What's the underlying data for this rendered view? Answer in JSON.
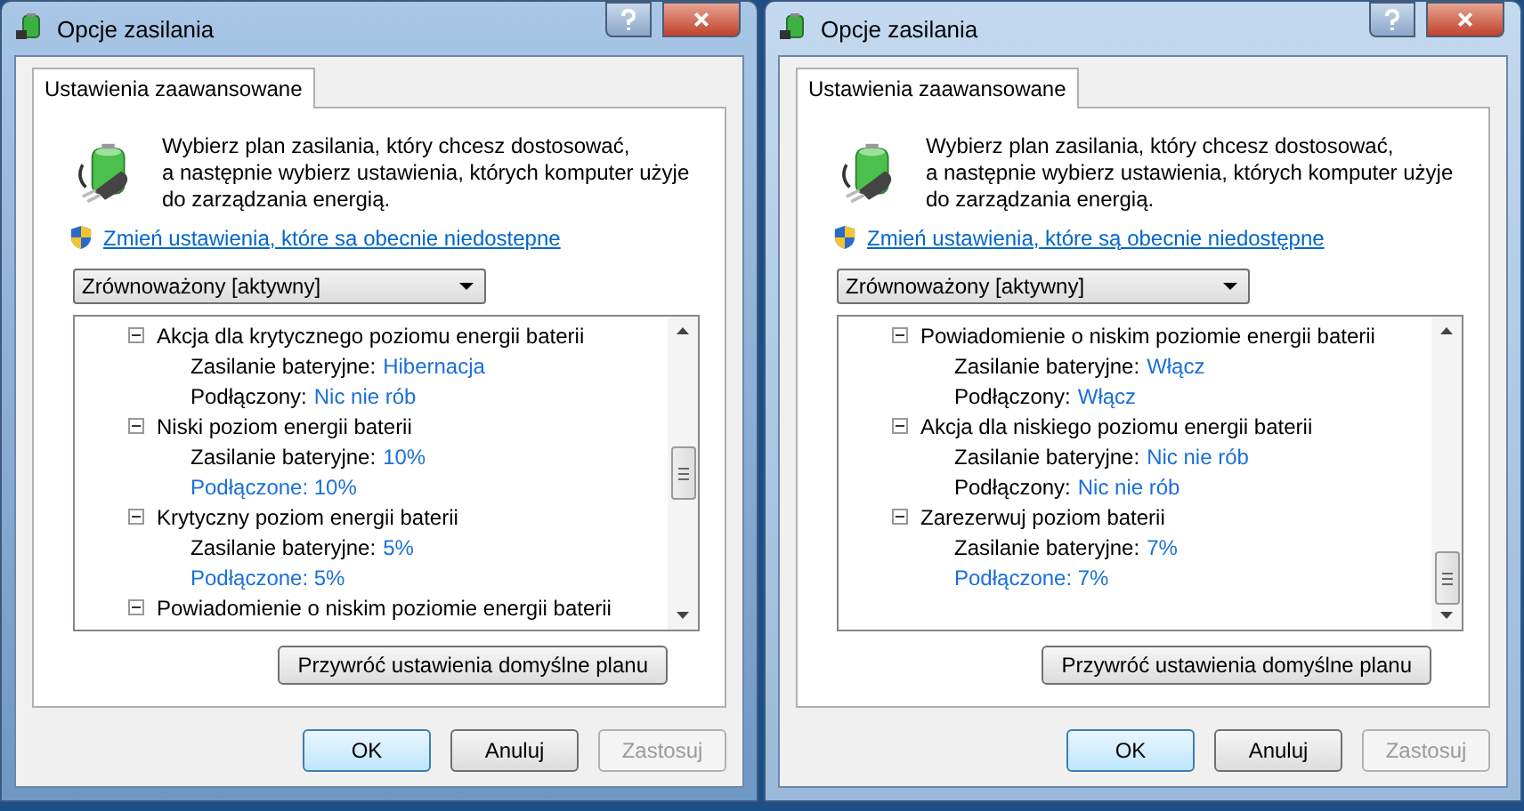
{
  "dialogs": [
    {
      "window": {
        "title": "Opcje zasilania"
      },
      "tabs": [
        {
          "label": "Ustawienia zaawansowane",
          "selected": true
        }
      ],
      "intro": [
        "Wybierz plan zasilania, który chcesz dostosować,",
        "a następnie wybierz ustawienia, których komputer użyje",
        "do zarządzania energią."
      ],
      "link": "Zmień ustawienia, które sa obecnie niedostepne",
      "plan_dropdown": {
        "value": "Zrównoważony [aktywny]"
      },
      "tree": [
        {
          "label": "Akcja dla krytycznego poziomu energii baterii",
          "expanded": true,
          "children": [
            {
              "kind": "pair",
              "label": "Zasilanie bateryjne:",
              "value": "Hibernacja"
            },
            {
              "kind": "pair",
              "label": "Podłączony:",
              "value": "Nic nie rób"
            }
          ]
        },
        {
          "label": "Niski poziom energii baterii",
          "expanded": true,
          "children": [
            {
              "kind": "pair",
              "label": "Zasilanie bateryjne:",
              "value": "10%"
            },
            {
              "kind": "link",
              "text": "Podłączone: 10%"
            }
          ]
        },
        {
          "label": "Krytyczny poziom energii baterii",
          "expanded": true,
          "children": [
            {
              "kind": "pair",
              "label": "Zasilanie bateryjne:",
              "value": "5%"
            },
            {
              "kind": "link",
              "text": "Podłączone: 5%"
            }
          ]
        },
        {
          "label": "Powiadomienie o niskim poziomie energii baterii",
          "expanded": true
        }
      ],
      "restore_button": "Przywróć ustawienia domyślne planu",
      "buttons": [
        {
          "label": "OK",
          "default": true,
          "disabled": false
        },
        {
          "label": "Anuluj",
          "default": false,
          "disabled": false
        },
        {
          "label": "Zastosuj",
          "default": false,
          "disabled": true
        }
      ]
    },
    {
      "window": {
        "title": "Opcje zasilania"
      },
      "tabs": [
        {
          "label": "Ustawienia zaawansowane",
          "selected": true
        }
      ],
      "intro": [
        "Wybierz plan zasilania, który chcesz dostosować,",
        "a następnie wybierz ustawienia, których komputer użyje",
        "do zarządzania energią."
      ],
      "link": "Zmień ustawienia, które są obecnie niedostępne",
      "plan_dropdown": {
        "value": "Zrównoważony [aktywny]"
      },
      "tree": [
        {
          "label": "Powiadomienie o niskim poziomie energii baterii",
          "expanded": true,
          "children": [
            {
              "kind": "pair",
              "label": "Zasilanie bateryjne:",
              "value": "Włącz"
            },
            {
              "kind": "pair",
              "label": "Podłączony:",
              "value": "Włącz"
            }
          ]
        },
        {
          "label": "Akcja dla niskiego poziomu energii baterii",
          "expanded": true,
          "children": [
            {
              "kind": "pair",
              "label": "Zasilanie bateryjne:",
              "value": "Nic nie rób"
            },
            {
              "kind": "pair",
              "label": "Podłączony:",
              "value": "Nic nie rób"
            }
          ]
        },
        {
          "label": "Zarezerwuj poziom baterii",
          "expanded": true,
          "children": [
            {
              "kind": "pair",
              "label": "Zasilanie bateryjne:",
              "value": "7%"
            },
            {
              "kind": "link",
              "text": "Podłączone: 7%"
            }
          ]
        }
      ],
      "restore_button": "Przywróć ustawienia domyślne planu",
      "buttons": [
        {
          "label": "OK",
          "default": true,
          "disabled": false
        },
        {
          "label": "Anuluj",
          "default": false,
          "disabled": false
        },
        {
          "label": "Zastosuj",
          "default": false,
          "disabled": true
        }
      ]
    }
  ]
}
